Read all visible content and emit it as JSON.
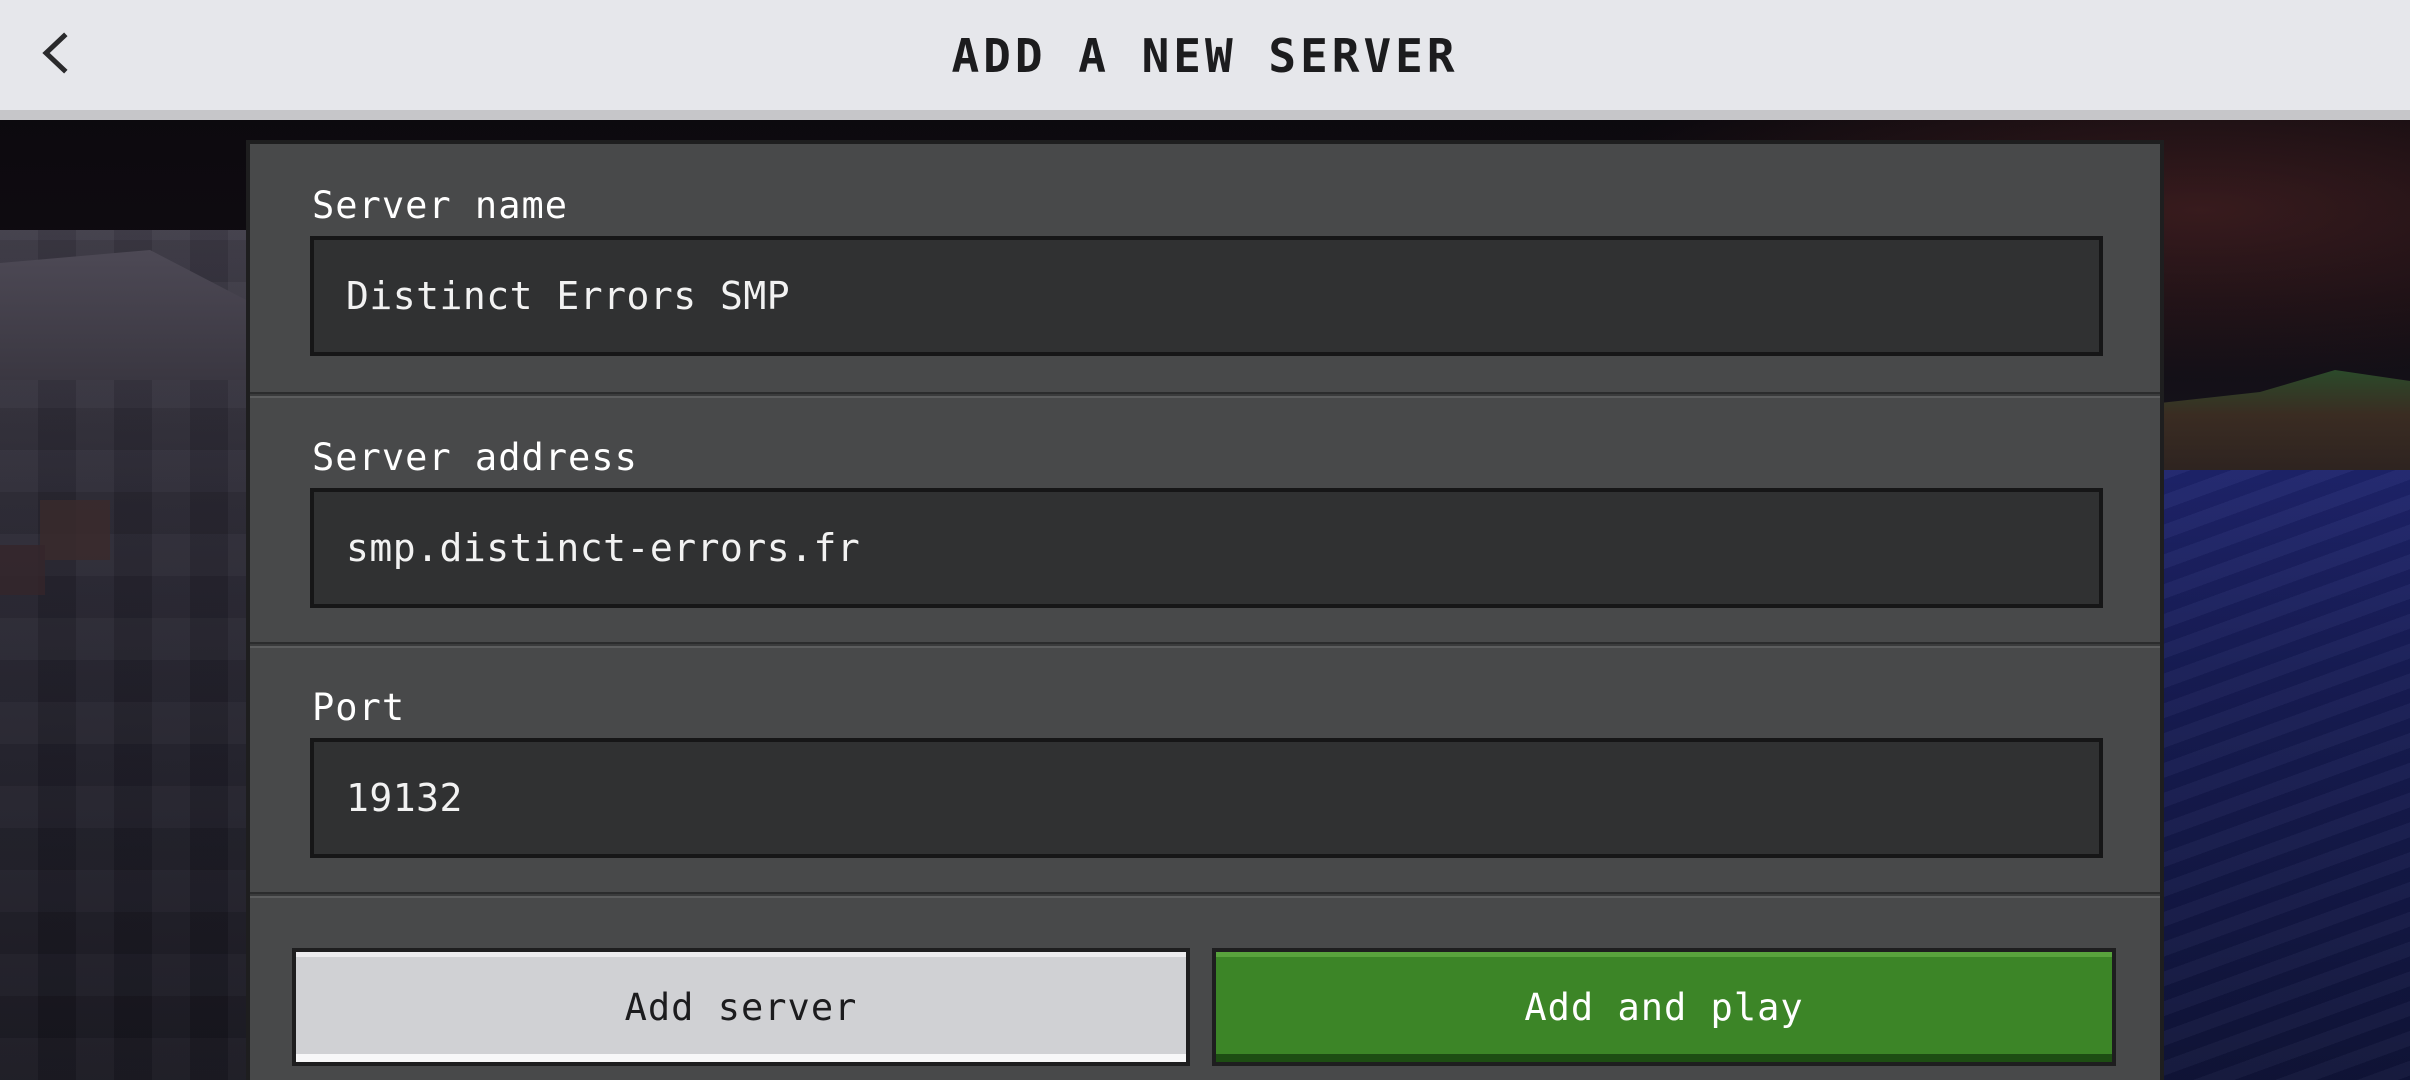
{
  "header": {
    "title": "ADD A NEW SERVER",
    "back_icon": "chevron-left-icon"
  },
  "form": {
    "server_name": {
      "label": "Server name",
      "value": "Distinct Errors SMP"
    },
    "server_address": {
      "label": "Server address",
      "value": "smp.distinct-errors.fr"
    },
    "port": {
      "label": "Port",
      "value": "19132"
    }
  },
  "actions": {
    "add_server_label": "Add server",
    "add_and_play_label": "Add and play"
  },
  "colors": {
    "header_bg": "#e6e7eb",
    "panel_bg": "#48494a",
    "input_bg": "#303132",
    "primary_green": "#3c8527",
    "secondary_gray": "#d0d1d4"
  }
}
